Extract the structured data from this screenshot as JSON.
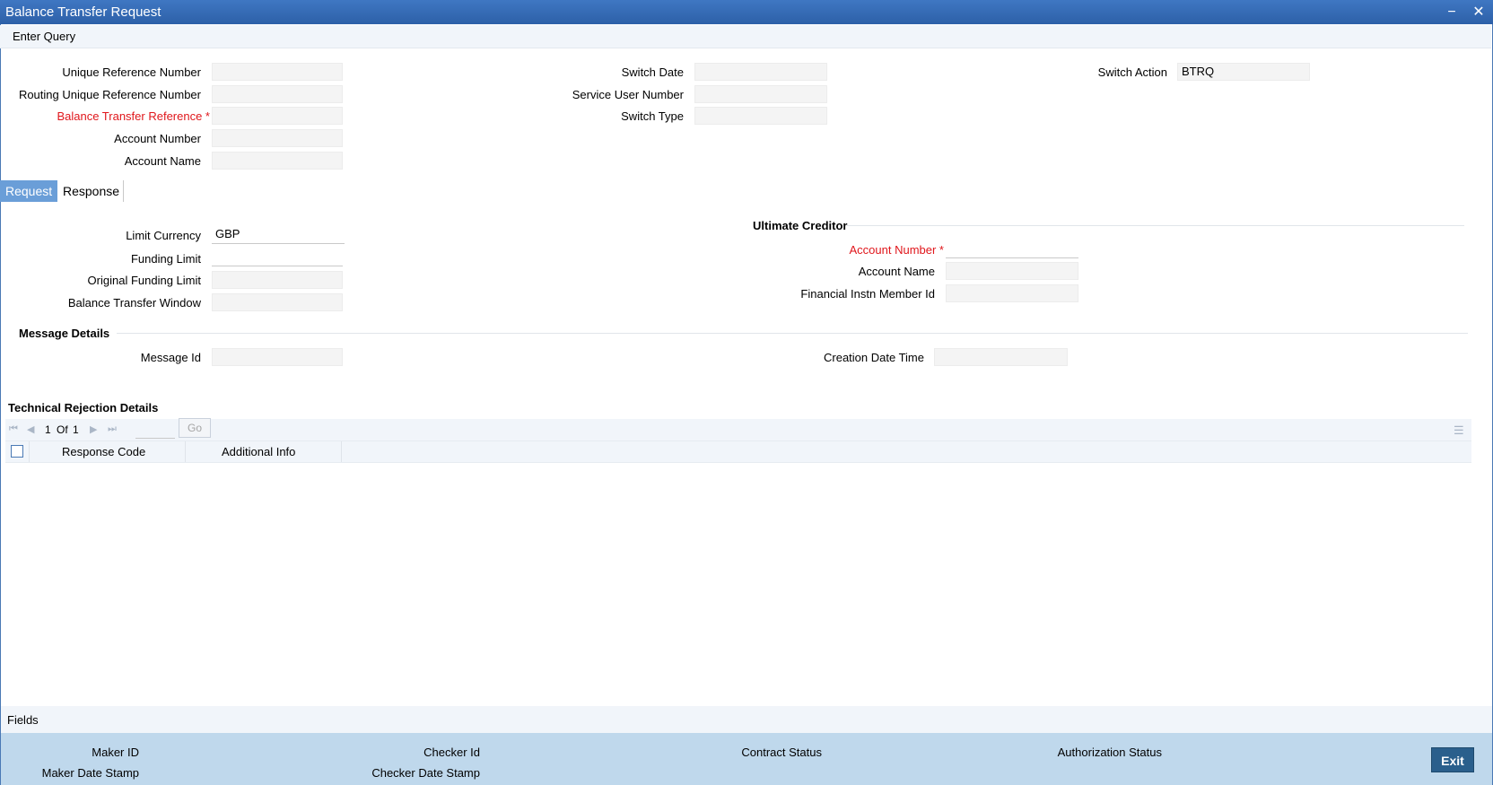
{
  "window": {
    "title": "Balance Transfer Request",
    "minimize_icon": "minimize-icon",
    "close_icon": "close-icon",
    "minimize_glyph": "−",
    "close_glyph": "✕"
  },
  "toolbar": {
    "enter_query": "Enter Query"
  },
  "header": {
    "unique_reference_number": {
      "label": "Unique Reference Number",
      "value": ""
    },
    "routing_unique_reference_number": {
      "label": "Routing Unique Reference Number",
      "value": ""
    },
    "balance_transfer_reference": {
      "label": "Balance Transfer Reference *",
      "value": ""
    },
    "account_number": {
      "label": "Account Number",
      "value": ""
    },
    "account_name": {
      "label": "Account Name",
      "value": ""
    },
    "switch_date": {
      "label": "Switch Date",
      "value": ""
    },
    "service_user_number": {
      "label": "Service User Number",
      "value": ""
    },
    "switch_type": {
      "label": "Switch Type",
      "value": ""
    },
    "switch_action": {
      "label": "Switch Action",
      "value": "BTRQ"
    }
  },
  "tabs": [
    {
      "label": "Request",
      "active": true
    },
    {
      "label": "Response",
      "active": false
    }
  ],
  "request": {
    "limit_currency": {
      "label": "Limit Currency",
      "value": "GBP"
    },
    "funding_limit": {
      "label": "Funding Limit",
      "value": ""
    },
    "original_funding_limit": {
      "label": "Original Funding Limit",
      "value": ""
    },
    "balance_transfer_window": {
      "label": "Balance Transfer Window",
      "value": ""
    },
    "ultimate_creditor": {
      "title": "Ultimate Creditor",
      "account_number": {
        "label": "Account Number *",
        "value": ""
      },
      "account_name": {
        "label": "Account Name",
        "value": ""
      },
      "financial_instn_member_id": {
        "label": "Financial Instn Member Id",
        "value": ""
      }
    }
  },
  "message_details": {
    "title": "Message Details",
    "message_id": {
      "label": "Message Id",
      "value": ""
    },
    "creation_date_time": {
      "label": "Creation Date Time",
      "value": ""
    }
  },
  "technical_rejection": {
    "title": "Technical Rejection Details",
    "pagination": {
      "current": "1",
      "of_label": "Of",
      "total": "1",
      "go_label": "Go",
      "page_input": ""
    },
    "columns": [
      "Response Code",
      "Additional Info"
    ],
    "rows": []
  },
  "footer": {
    "fields_label": "Fields",
    "maker_id": "Maker ID",
    "maker_date_stamp": "Maker Date Stamp",
    "checker_id": "Checker Id",
    "checker_date_stamp": "Checker Date Stamp",
    "contract_status": "Contract Status",
    "authorization_status": "Authorization Status",
    "exit_label": "Exit"
  },
  "colors": {
    "title_bar": "#2d60a8",
    "required_label": "#e0161b",
    "active_tab": "#6a9ed8",
    "audit_bar": "#bfd8ec",
    "exit_button": "#2a5f8c"
  }
}
